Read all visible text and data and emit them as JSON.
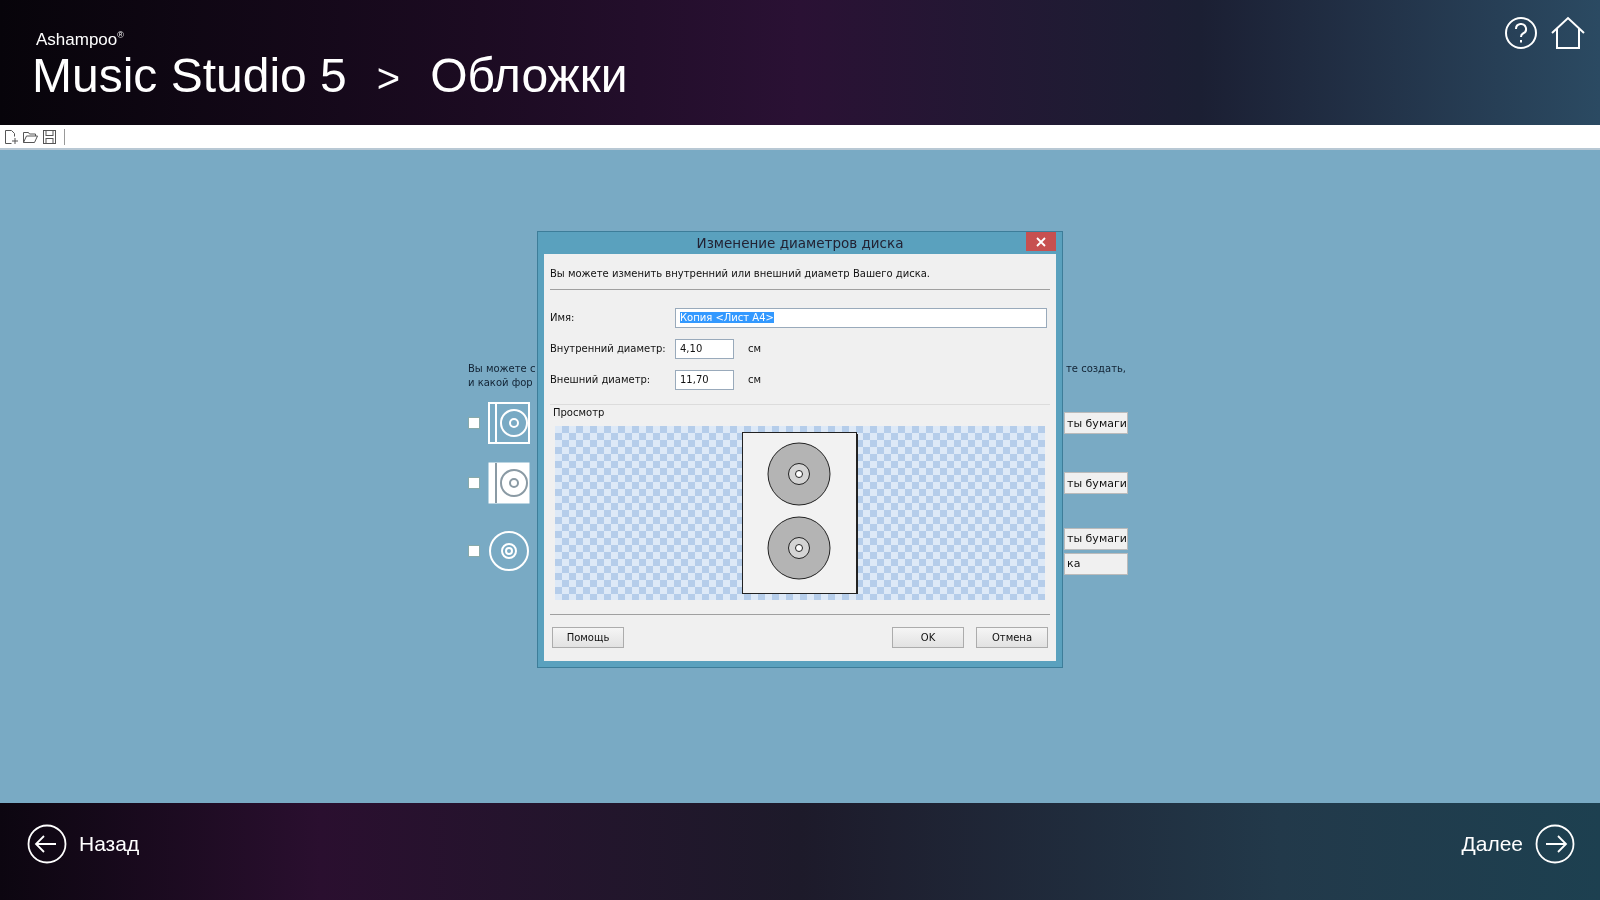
{
  "header": {
    "brand": "Ashampoo$^{®}$",
    "product": "Music Studio 5",
    "separator": ">",
    "page_title": "Обложки"
  },
  "background": {
    "intro_left": [
      "Вы можете с",
      "и какой фор"
    ],
    "intro_right": "те создать,",
    "options": [
      {
        "kind": "case",
        "checked": false,
        "buttons": [
          "ты бумаги"
        ]
      },
      {
        "kind": "case-white",
        "checked": false,
        "buttons": [
          "ты бумаги"
        ]
      },
      {
        "kind": "disc",
        "checked": false,
        "buttons": [
          "ты бумаги",
          "ка"
        ]
      }
    ]
  },
  "dialog": {
    "title": "Изменение диаметров диска",
    "description": "Вы можете изменить внутренний или внешний диаметр Вашего диска.",
    "fields": [
      {
        "kind": "wide",
        "label": "Имя:",
        "value": "Копия <Лист А4>",
        "selected": true
      },
      {
        "kind": "number",
        "label": "Внутренний диаметр:",
        "value": "4,10",
        "unit": "см",
        "selected": false
      },
      {
        "kind": "number",
        "label": "Внешний диаметр:",
        "value": "11,70",
        "unit": "см",
        "selected": false
      }
    ],
    "preview_label": "Просмотр",
    "help_button": "Помощь",
    "buttons": [
      "OK",
      "Отмена"
    ]
  },
  "footer": {
    "back": "Назад",
    "next": "Далее"
  }
}
